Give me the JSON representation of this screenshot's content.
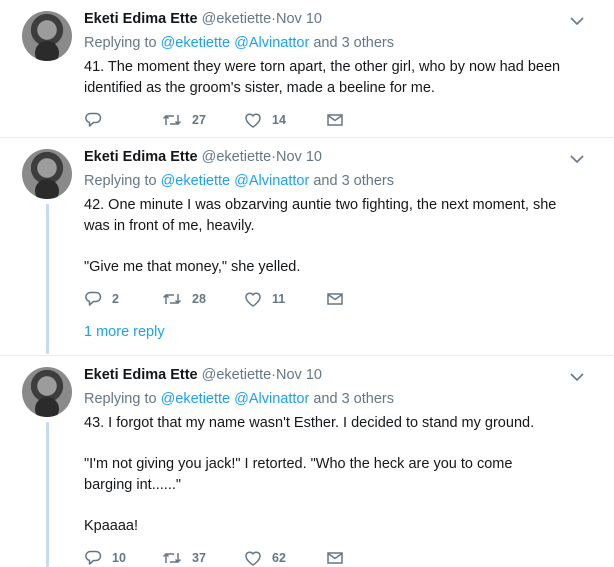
{
  "tweets": [
    {
      "name": "Eketi Edima Ette",
      "handle": "@eketiette",
      "time": "·Nov 10",
      "replying_prefix": "Replying to",
      "mentions": [
        "@eketiette",
        "@Alvinattor"
      ],
      "replying_suffix": "and 3 others",
      "paragraphs": [
        "41. The moment they were torn apart, the other girl, who by now had been identified as the groom's sister, made a beeline for me."
      ],
      "replies": "",
      "retweets": "27",
      "likes": "14"
    },
    {
      "name": "Eketi Edima Ette",
      "handle": "@eketiette",
      "time": "·Nov 10",
      "replying_prefix": "Replying to",
      "mentions": [
        "@eketiette",
        "@Alvinattor"
      ],
      "replying_suffix": "and 3 others",
      "paragraphs": [
        "42. One minute I was obzarving auntie two fighting, the next moment, she was in front of me, heavily.",
        "\"Give me that money,\" she yelled."
      ],
      "replies": "2",
      "retweets": "28",
      "likes": "11"
    },
    {
      "name": "Eketi Edima Ette",
      "handle": "@eketiette",
      "time": "·Nov 10",
      "replying_prefix": "Replying to",
      "mentions": [
        "@eketiette",
        "@Alvinattor"
      ],
      "replying_suffix": "and 3 others",
      "paragraphs": [
        "43. I forgot that my name wasn't Esther. I decided to stand my ground.",
        "\"I'm not giving you jack!\" I retorted. \"Who the heck are you to come barging int......\"",
        "Kpaaaa!"
      ],
      "replies": "10",
      "retweets": "37",
      "likes": "62"
    }
  ],
  "more_reply": "1 more reply",
  "icons": {
    "reply": "reply-icon",
    "retweet": "retweet-icon",
    "like": "heart-icon",
    "message": "envelope-icon",
    "menu": "chevron-down-icon"
  },
  "colors": {
    "link": "#1da1f2",
    "muted": "#657786",
    "thread": "#c4dcf1",
    "divider": "#e6ecf0"
  }
}
